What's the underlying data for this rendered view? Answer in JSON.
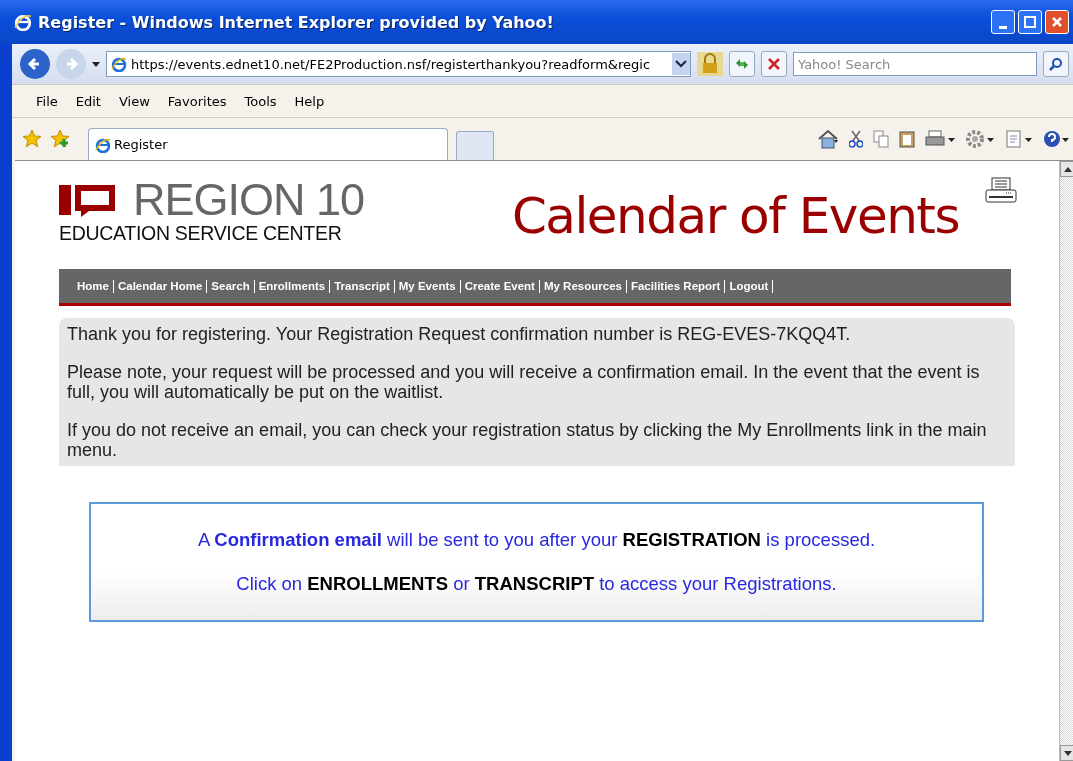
{
  "window": {
    "title": "Register - Windows Internet Explorer provided by Yahoo!"
  },
  "address_bar": {
    "url": "https://events.ednet10.net/FE2Production.nsf/registerthankyou?readform&regic"
  },
  "search": {
    "placeholder": "Yahoo! Search"
  },
  "menu": [
    "File",
    "Edit",
    "View",
    "Favorites",
    "Tools",
    "Help"
  ],
  "tabs": [
    {
      "label": "Register",
      "selected": true
    }
  ],
  "page": {
    "logo": {
      "line1": "REGION 10",
      "line2": "EDUCATION SERVICE CENTER"
    },
    "heading": "Calendar of Events",
    "nav": [
      "Home",
      "Calendar Home",
      "Search",
      "Enrollments",
      "Transcript",
      "My Events",
      "Create Event",
      "My Resources",
      "Facilities Report",
      "Logout"
    ],
    "notice": [
      "Thank you for registering. Your Registration Request confirmation number is REG-EVES-7KQQ4T.",
      "Please note, your request will be processed and you will receive a confirmation email. In the event that the event is full, you will automatically be put on the waitlist.",
      "If you do not receive an email, you can check your registration status by clicking the My Enrollments link in the main menu."
    ],
    "callout": [
      [
        {
          "kind": "plain",
          "text": "A "
        },
        {
          "kind": "link",
          "text": "Confirmation email"
        },
        {
          "kind": "plain",
          "text": " will be sent to you after your "
        },
        {
          "kind": "strong",
          "text": "REGISTRATION"
        },
        {
          "kind": "plain",
          "text": " is processed."
        }
      ],
      [
        {
          "kind": "plain",
          "text": "Click on "
        },
        {
          "kind": "strong",
          "text": "ENROLLMENTS"
        },
        {
          "kind": "plain",
          "text": " or "
        },
        {
          "kind": "strong",
          "text": "TRANSCRIPT"
        },
        {
          "kind": "plain",
          "text": " to access your Registrations."
        }
      ]
    ]
  }
}
